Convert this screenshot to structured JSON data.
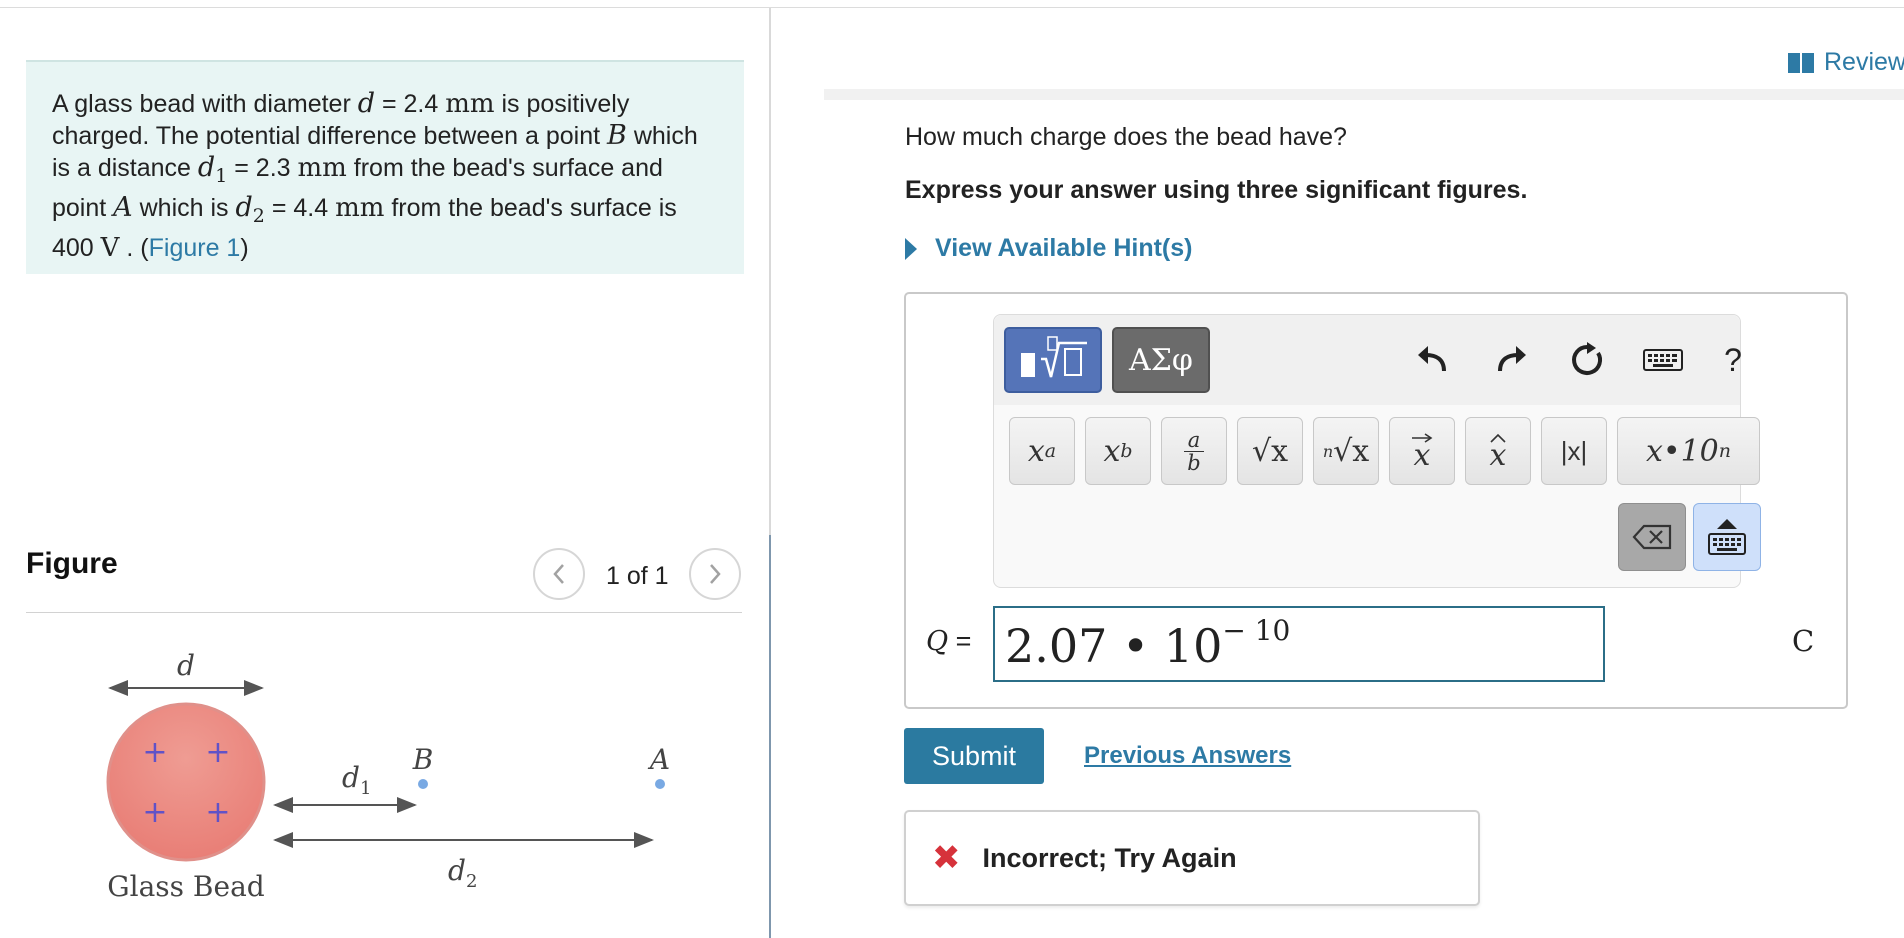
{
  "problem": {
    "t1": "A glass bead with diameter ",
    "d_var": "d",
    "t2": " = 2.4 ",
    "mm1": "mm",
    "t3": "  is positively charged. The potential difference between a point ",
    "B_var": "B",
    "t4": " which is a distance  ",
    "d1_var": "d",
    "d1_sub": "1",
    "t5": " = 2.3 ",
    "mm2": "mm",
    "t6": " from the bead's surface and point ",
    "A_var": "A",
    "t7": " which is ",
    "d2_var": "d",
    "d2_sub": "2",
    "t8": " = 4.4 ",
    "mm3": "mm",
    "t9": " from the bead's surface is 400 ",
    "volt": "V",
    "t10": " . (",
    "figure_link": "Figure 1",
    "t11": ")"
  },
  "figure": {
    "title": "Figure",
    "page_count": "1 of 1",
    "prev_icon": "chevron-left-icon",
    "next_icon": "chevron-right-icon",
    "label_d": "d",
    "label_d1": "d",
    "label_d1_sub": "1",
    "label_d2": "d",
    "label_d2_sub": "2",
    "label_B": "B",
    "label_A": "A",
    "bead_label": "Glass Bead",
    "plus": "+",
    "bead_color": "#ec8f87",
    "point_color": "#79a9e3"
  },
  "review": {
    "label": "Review"
  },
  "question": {
    "text": "How much charge does the bead have?",
    "instruction": "Express your answer using three significant figures.",
    "hints_label": "View Available Hint(s)"
  },
  "toolbar": {
    "symbol_mode": "ΑΣφ",
    "help": "?",
    "keys": {
      "superscript": {
        "base": "x",
        "exp": "a"
      },
      "subscript": {
        "base": "x",
        "sub": "b"
      },
      "fraction": {
        "num": "a",
        "den": "b"
      },
      "sqrt": "√x",
      "nthroot": {
        "index": "n",
        "body": "√x"
      },
      "vector": "x",
      "unit_vector": "x",
      "abs": "|x|",
      "sci": "x•10",
      "sci_exp": "n"
    }
  },
  "answer": {
    "variable": "Q",
    "equals": " =",
    "mantissa": "2.07 • 10",
    "exponent": "− 10",
    "unit": "C"
  },
  "actions": {
    "submit": "Submit",
    "previous_answers": "Previous Answers"
  },
  "feedback": {
    "mark": "✖",
    "text": "Incorrect; Try Again"
  }
}
